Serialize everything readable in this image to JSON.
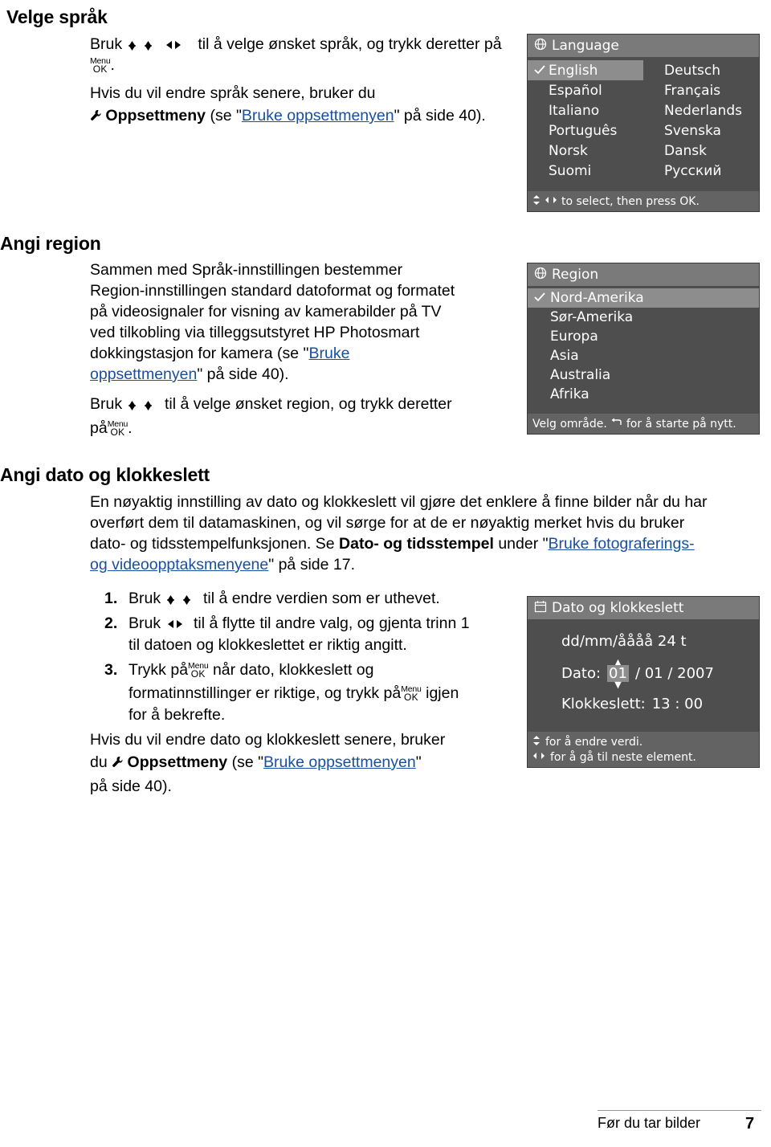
{
  "sections": {
    "language": {
      "heading": "Velge språk",
      "p1_a": "Bruk",
      "p1_b": "til å velge ønsket språk, og trykk deretter på",
      "p1_c": ".",
      "p2_a": "Hvis du vil endre språk senere, bruker du",
      "p2_b": "Oppsettmeny",
      "p2_c": "(se \"",
      "p2_link": "Bruke oppsettmenyen",
      "p2_d": "\" på side 40)."
    },
    "region": {
      "heading": "Angi region",
      "p1_l1": "Sammen med Språk-innstillingen bestemmer",
      "p1_l2": "Region-innstillingen standard datoformat og formatet",
      "p1_l3": "på videosignaler for visning av kamerabilder på TV",
      "p1_l4": "ved tilkobling via tilleggsutstyret HP Photosmart",
      "p1_l5": "dokkingstasjon for kamera (se \"",
      "p1_link1": "Bruke",
      "p1_link2": "oppsettmenyen",
      "p1_l6": "\" på side 40).",
      "p2_a": "Bruk",
      "p2_b": "til å velge ønsket region, og trykk deretter",
      "p2_c": "på",
      "p2_d": "."
    },
    "datetime": {
      "heading": "Angi dato og klokkeslett",
      "p1_l1": "En nøyaktig innstilling av dato og klokkeslett vil gjøre det enklere å finne bilder når du har",
      "p1_l2": "overført dem til datamaskinen, og vil sørge for at de er nøyaktig merket hvis du bruker",
      "p1_l3_a": "dato- og tidsstempelfunksjonen. Se",
      "p1_l3_b": "Dato- og tidsstempel",
      "p1_l3_c": "under \"",
      "p1_link_a": "Bruke fotograferings-",
      "p1_link_b": "og videoopptaksmenyene",
      "p1_l4": "\" på side 17.",
      "steps": [
        {
          "num": "1.",
          "a": "Bruk",
          "b": "til å endre verdien som er uthevet."
        },
        {
          "num": "2.",
          "a": "Bruk",
          "b": "til å flytte til andre valg, og gjenta trinn 1",
          "c": "til datoen og klokkeslettet er riktig angitt."
        },
        {
          "num": "3.",
          "a": "Trykk på",
          "b": "når dato, klokkeslett og",
          "c": "formatinnstillinger er riktige, og trykk på",
          "d": "igjen",
          "e": "for å bekrefte."
        }
      ],
      "p2_l1": "Hvis du vil endre dato og klokkeslett senere, bruker",
      "p2_l2_a": "du",
      "p2_l2_b": "Oppsettmeny",
      "p2_l2_c": "(se \"",
      "p2_link": "Bruke oppsettmenyen",
      "p2_l2_d": "\"",
      "p2_l3": "på side 40)."
    }
  },
  "lcd_language": {
    "title": "Language",
    "options_left": [
      "English",
      "Español",
      "Italiano",
      "Português",
      "Norsk",
      "Suomi"
    ],
    "options_right": [
      "Deutsch",
      "Français",
      "Nederlands",
      "Svenska",
      "Dansk",
      "Русский"
    ],
    "selected": "English",
    "status": "to select, then press OK."
  },
  "lcd_region": {
    "title": "Region",
    "options": [
      "Nord-Amerika",
      "Sør-Amerika",
      "Europa",
      "Asia",
      "Australia",
      "Afrika"
    ],
    "selected": "Nord-Amerika",
    "status_a": "Velg område.",
    "status_b": "for å starte på nytt."
  },
  "lcd_datetime": {
    "title": "Dato og klokkeslett",
    "format_line": "dd/mm/åååå  24 t",
    "date_label": "Dato:",
    "date_hl": "01",
    "date_rest": "/ 01 / 2007",
    "time_label": "Klokkeslett:",
    "time_value": "13 : 00",
    "status_l1": "for å endre verdi.",
    "status_l2": "for å gå til neste element."
  },
  "footer": {
    "text": "Før du tar bilder",
    "page": "7"
  },
  "icons": {
    "menu_label": "Menu",
    "ok_label": "OK"
  },
  "colors": {
    "link": "#1a4fa0",
    "lcd_bg": "#4e4e4e",
    "lcd_title_bg": "#7a7a7a",
    "lcd_selected_bg": "#8d8d8d"
  }
}
